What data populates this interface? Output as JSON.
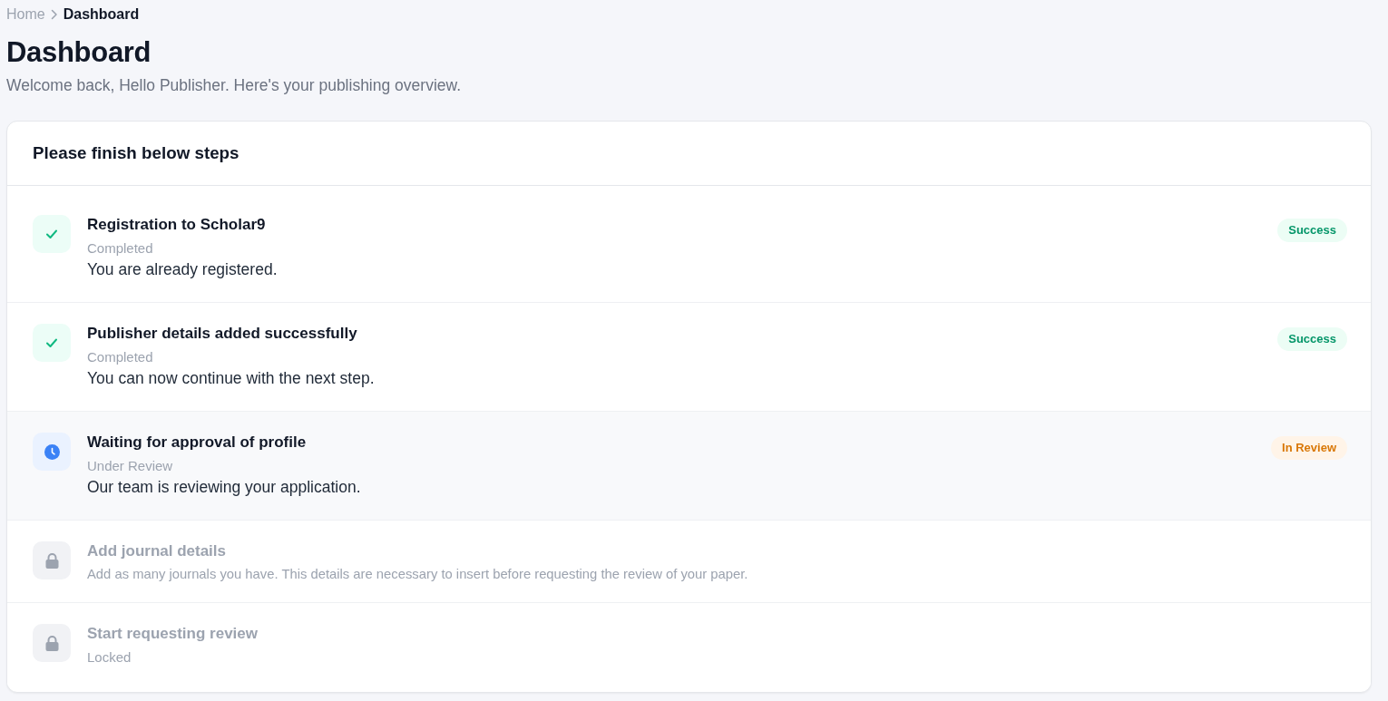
{
  "breadcrumb": {
    "items": [
      {
        "label": "Home",
        "current": false
      },
      {
        "label": "Dashboard",
        "current": true
      }
    ]
  },
  "page": {
    "title": "Dashboard",
    "subtitle": "Welcome back, Hello Publisher. Here's your publishing overview."
  },
  "steps_card": {
    "title": "Please finish below steps",
    "steps": [
      {
        "kind": "completed",
        "title": "Registration to Scholar9",
        "status": "Completed",
        "description": "You are already registered.",
        "badge": "Success"
      },
      {
        "kind": "completed",
        "title": "Publisher details added successfully",
        "status": "Completed",
        "description": "You can now continue with the next step.",
        "badge": "Success"
      },
      {
        "kind": "review",
        "title": "Waiting for approval of profile",
        "status": "Under Review",
        "description": "Our team is reviewing your application.",
        "badge": "In Review"
      },
      {
        "kind": "locked",
        "title": "Add journal details",
        "description": "Add as many journals you have. This details are necessary to insert before requesting the review of your paper."
      },
      {
        "kind": "locked",
        "title": "Start requesting review",
        "status": "Locked"
      }
    ]
  }
}
